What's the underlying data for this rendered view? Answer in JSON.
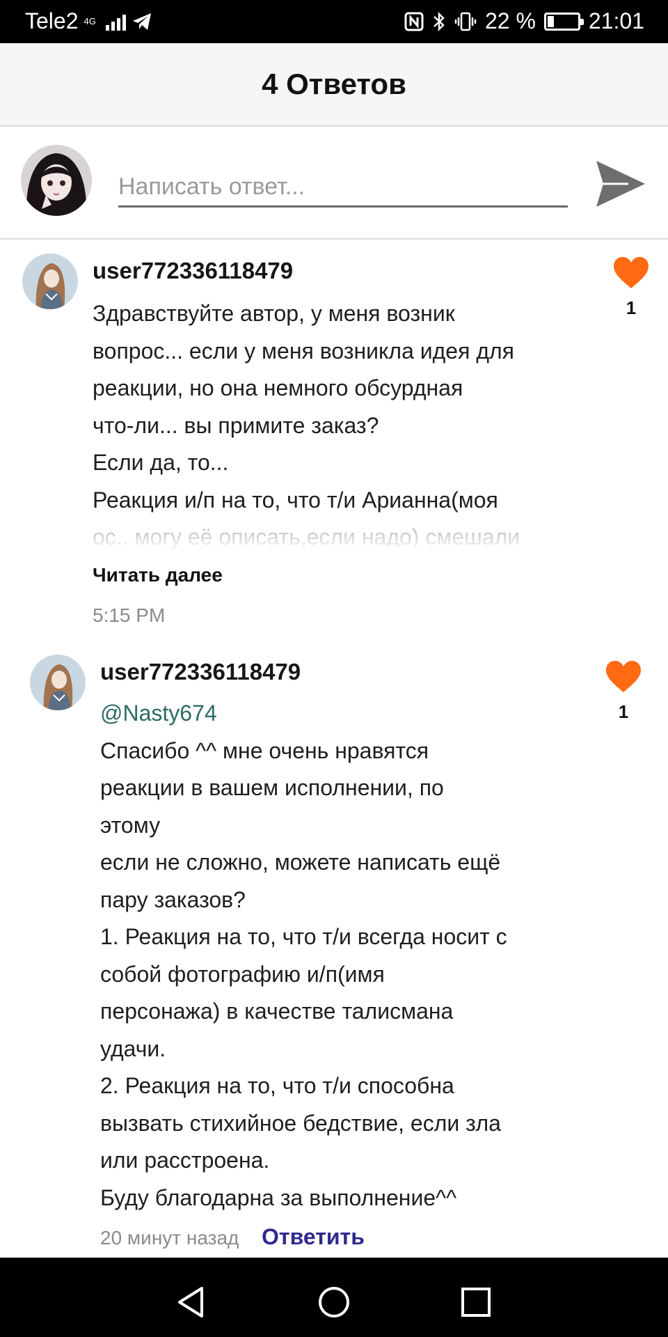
{
  "status_bar": {
    "carrier": "Tele2",
    "network_type": "4G",
    "battery_percent": "22 %",
    "battery_level": 0.22,
    "time": "21:01"
  },
  "header": {
    "title": "4 Ответов"
  },
  "composer": {
    "placeholder": "Написать ответ...",
    "value": ""
  },
  "comments": [
    {
      "author": "user772336118479",
      "lines": [
        "Здравствуйте автор, у меня возник",
        "вопрос... если у меня возникла идея для",
        "реакции, но она немного обсурдная",
        "что-ли... вы примите заказ?",
        "Если да, то...",
        "Реакция и/п на то, что т/и Арианна(моя",
        "ос.. могу её описать,если надо) смешали"
      ],
      "read_more": "Читать далее",
      "time": "5:15 PM",
      "likes": "1"
    },
    {
      "author": "user772336118479",
      "mention": "@Nasty674",
      "lines": [
        "Спасибо ^^ мне очень нравятся",
        "реакции в вашем исполнении, по",
        "этому",
        "если не сложно, можете написать ещё",
        "пару заказов?",
        "1. Реакция на то, что т/и всегда носит с",
        "собой фотографию и/п(имя",
        "персонажа) в качестве талисмана",
        "удачи.",
        "2. Реакция на то, что т/и способна",
        "вызвать стихийное бедствие, если зла",
        "или расстроена.",
        "Буду благодарна за выполнение^^"
      ],
      "time": "20 минут назад",
      "reply_label": "Ответить",
      "likes": "1"
    }
  ],
  "colors": {
    "heart": "#ff6a13",
    "reply_link": "#2e2a8f",
    "mention": "#2f6b66"
  },
  "icons": {
    "send": "send-icon",
    "like": "heart-icon",
    "nav_back": "triangle-back-icon",
    "nav_home": "circle-home-icon",
    "nav_recent": "square-recents-icon"
  }
}
